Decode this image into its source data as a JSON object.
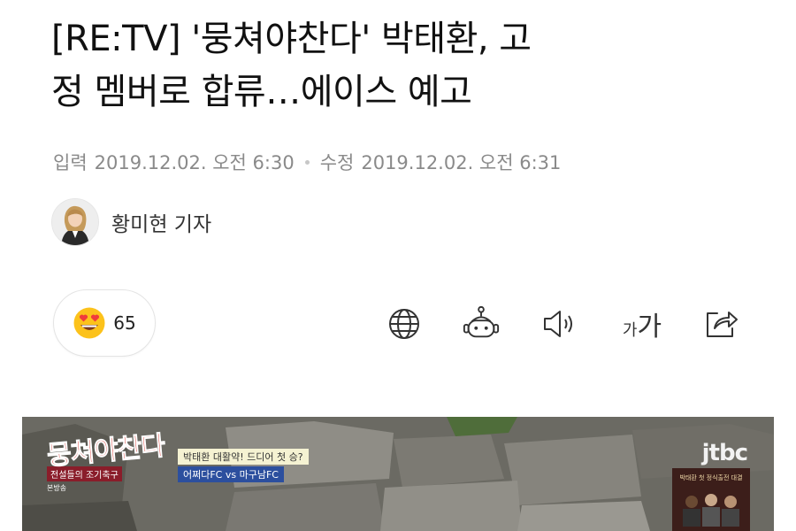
{
  "article": {
    "headline_line1": "[RE:TV] '뭉쳐야찬다' 박태환, 고",
    "headline_line2": "정 멤버로 합류…에이스 예고",
    "input_label": "입력",
    "input_time": "2019.12.02. 오전 6:30",
    "edit_label": "수정",
    "edit_time": "2019.12.02. 오전 6:31",
    "author": "황미현 기자"
  },
  "reactions": {
    "emoji_icon": "heart-eyes-emoji-icon",
    "count": "65"
  },
  "toolbar": {
    "icons": [
      "globe-icon",
      "robot-summary-icon",
      "speaker-icon",
      "font-size-icon",
      "share-icon"
    ],
    "font_small": "가",
    "font_large": "가"
  },
  "video": {
    "show_logo": "뭉쳐야찬다",
    "show_sub": "전설들의 조기축구",
    "caption_top": "박태환 대활약! 드디어 첫 승?",
    "caption_bottom": "어쩌다FC vs 마구남FC",
    "rerun_tag": "본방송",
    "channel": "jtbc",
    "side_title": "박태환 첫 정식출전 대결"
  },
  "colors": {
    "meta_text": "#8a8a8a",
    "border": "#e4e4e4",
    "emoji_yellow": "#fcc21b",
    "emoji_heart": "#f03c3c",
    "show_logo_red": "#d6322b"
  }
}
